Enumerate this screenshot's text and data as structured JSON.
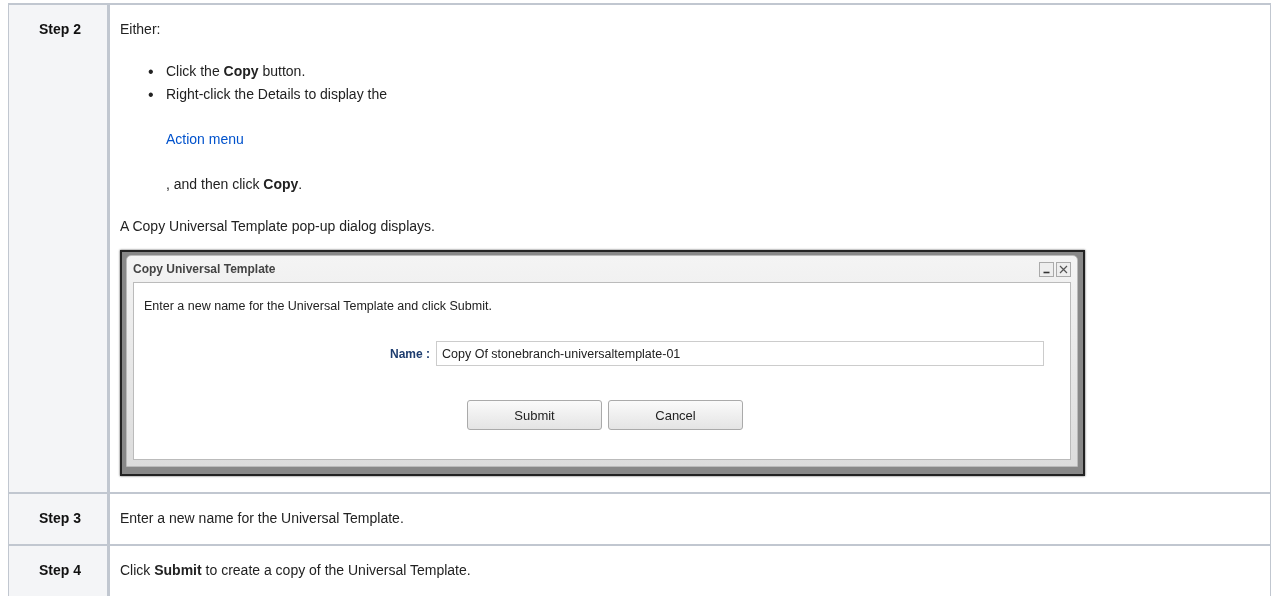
{
  "steps": [
    {
      "label": "Step 2",
      "intro": "Either:",
      "bullets": [
        {
          "marker": "•",
          "text": "Click the **Copy** button."
        },
        {
          "marker": "•",
          "text": "Right-click the Details to display the",
          "link": "Action menu",
          "after": ", and then click **Copy**."
        }
      ],
      "note": "A Copy Universal Template pop-up dialog displays.",
      "dialog": {
        "title": "Copy Universal Template",
        "message": "Enter a new name for the Universal Template and click Submit.",
        "field_label": "Name :",
        "field_value": "Copy Of stonebranch-universaltemplate-01",
        "buttons": [
          "Submit",
          "Cancel"
        ]
      }
    },
    {
      "label": "Step 3",
      "text": "Enter a new name for the Universal Template."
    },
    {
      "label": "Step 4",
      "text": "Click **Submit** to create a copy of the Universal Template."
    }
  ]
}
